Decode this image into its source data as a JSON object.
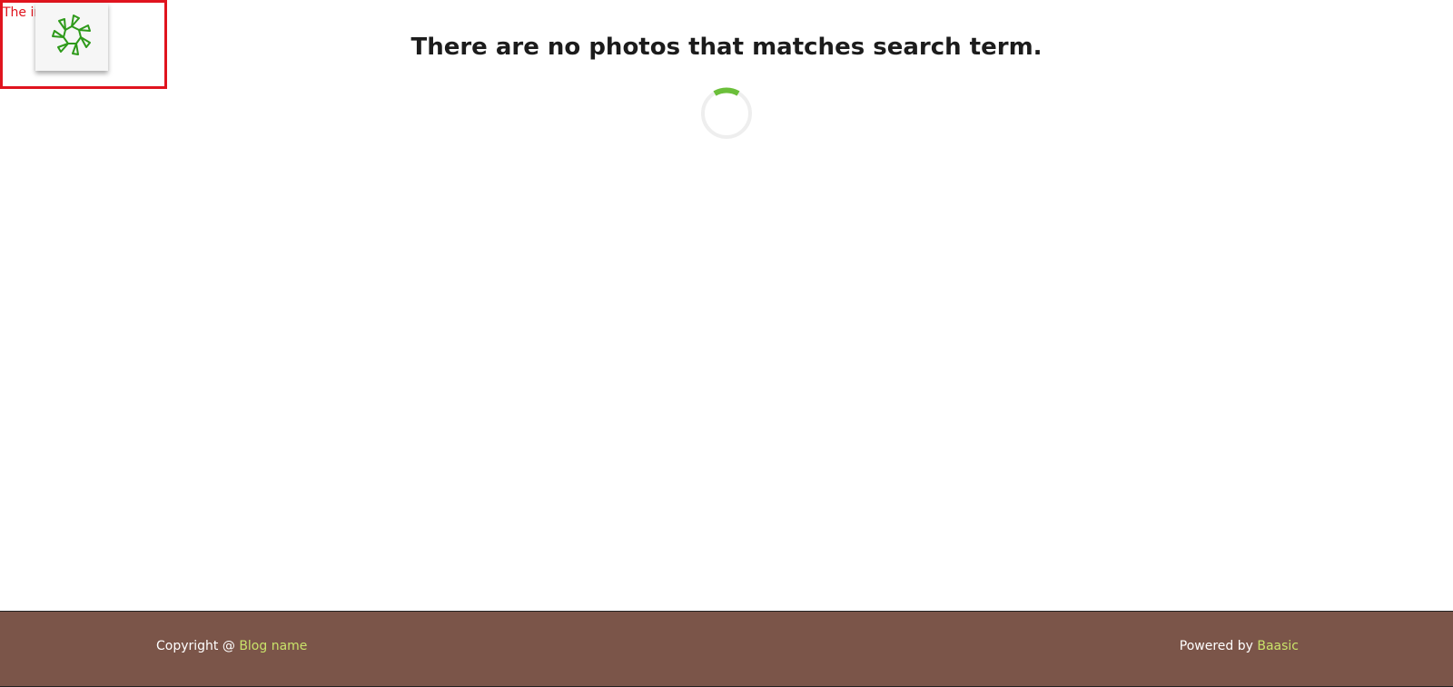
{
  "error_banner": {
    "text": "The         invalid."
  },
  "logo": {
    "icon": "sunburst-logo-icon",
    "color": "#2e9a1a"
  },
  "main": {
    "headline": "There are no photos that matches search term.",
    "loader_icon": "loading-spinner-icon",
    "loader_color": "#6bbf3a"
  },
  "footer": {
    "copyright_prefix": "Copyright @ ",
    "blog_link": "Blog name",
    "powered_prefix": "Powered by ",
    "baasic_link": "Baasic",
    "background_color": "#7b5549",
    "link_color": "#c9e36a"
  }
}
